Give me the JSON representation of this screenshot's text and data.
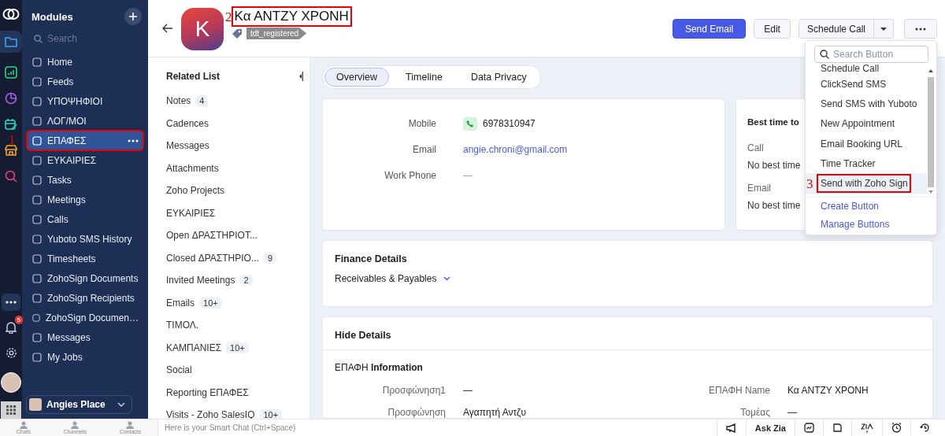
{
  "rail": {
    "notification_count": "5"
  },
  "sidebar": {
    "title": "Modules",
    "search": {
      "placeholder": "Search"
    },
    "items": [
      {
        "label": "Home",
        "selected": false
      },
      {
        "label": "Feeds",
        "selected": false
      },
      {
        "label": "ΥΠΟΨΗΦΙΟΙ",
        "selected": false
      },
      {
        "label": "ΛΟΓ/ΜΟΙ",
        "selected": false
      },
      {
        "label": "ΕΠΑΦΕΣ",
        "selected": true,
        "annotation": "1"
      },
      {
        "label": "ΕΥΚΑΙΡΙΕΣ",
        "selected": false
      },
      {
        "label": "Tasks",
        "selected": false
      },
      {
        "label": "Meetings",
        "selected": false
      },
      {
        "label": "Calls",
        "selected": false
      },
      {
        "label": "Yuboto SMS History",
        "selected": false
      },
      {
        "label": "Timesheets",
        "selected": false
      },
      {
        "label": "ZohoSign Documents",
        "selected": false
      },
      {
        "label": "ZohoSign Recipients",
        "selected": false
      },
      {
        "label": "ZohoSign Documen…",
        "selected": false
      },
      {
        "label": "Messages",
        "selected": false
      },
      {
        "label": "My Jobs",
        "selected": false
      }
    ],
    "org": "Angies Place"
  },
  "header": {
    "avatar_letter": "K",
    "name": "Κα ΑΝΤΖΥ ΧΡΟΝΗ",
    "annotation": "2",
    "tag": "tdt_registered",
    "send_email": "Send Email",
    "edit": "Edit",
    "schedule_call": "Schedule Call"
  },
  "related": {
    "title": "Related List",
    "items": [
      {
        "label": "Notes",
        "count": "4"
      },
      {
        "label": "Cadences"
      },
      {
        "label": "Messages"
      },
      {
        "label": "Attachments"
      },
      {
        "label": "Zoho Projects"
      },
      {
        "label": "ΕΥΚΑΙΡΙΕΣ"
      },
      {
        "label": "Open ΔΡΑΣΤΗΡΙΟΤ..."
      },
      {
        "label": "Closed ΔΡΑΣΤΗΡΙΟ...",
        "count": "9"
      },
      {
        "label": "Invited Meetings",
        "count": "2"
      },
      {
        "label": "Emails",
        "count": "10+"
      },
      {
        "label": "ΤΙΜΟΛ."
      },
      {
        "label": "ΚΑΜΠΑΝΙΕΣ",
        "count": "10+"
      },
      {
        "label": "Social"
      },
      {
        "label": "Reporting ΕΠΑΦΕΣ"
      },
      {
        "label": "Visits - Zoho SalesIQ",
        "count": "10+"
      }
    ]
  },
  "tabs": [
    {
      "label": "Overview",
      "selected": true
    },
    {
      "label": "Timeline",
      "selected": false
    },
    {
      "label": "Data Privacy",
      "selected": false
    }
  ],
  "contact_card": {
    "fields": [
      {
        "label": "Mobile",
        "value": "6978310947",
        "kind": "phone"
      },
      {
        "label": "Email",
        "value": "angie.chroni@gmail.com",
        "kind": "link"
      },
      {
        "label": "Work Phone",
        "value": "—",
        "kind": "empty"
      }
    ]
  },
  "best_time": {
    "title": "Best time to",
    "rows": [
      {
        "label": "Call",
        "value": "No best time"
      },
      {
        "label": "Email",
        "value": "No best time"
      }
    ]
  },
  "finance": {
    "title": "Finance Details",
    "toggle": "Receivables & Payables"
  },
  "details": {
    "title": "Hide Details",
    "section": "ΕΠΑΦΗ **Information**",
    "fields": [
      {
        "label": "Προσφώνηση1",
        "value": "—"
      },
      {
        "label": "ΕΠΑΦΗ Name",
        "value": "Κα ΑΝΤΖΥ ΧΡΟΝΗ"
      },
      {
        "label": "Προσφώνηση",
        "value": "Αγαπητή Αντζυ"
      },
      {
        "label": "Τομέας",
        "value": "—"
      }
    ]
  },
  "dropdown": {
    "search": {
      "placeholder": "Search Button"
    },
    "items": [
      {
        "label": "Schedule Call",
        "selected": false
      },
      {
        "label": "ClickSend SMS",
        "selected": false
      },
      {
        "label": "Send SMS with Yuboto",
        "selected": false
      },
      {
        "label": "New Appointment",
        "selected": false
      },
      {
        "label": "Email Booking URL",
        "selected": false
      },
      {
        "label": "Time Tracker",
        "selected": false
      },
      {
        "label": "Send with Zoho Sign",
        "selected": true,
        "annotation": "3"
      }
    ],
    "links": [
      "Create Button",
      "Manage Buttons"
    ]
  },
  "dock": [
    "Chats",
    "Channels",
    "Contacts"
  ],
  "smart_chat": {
    "placeholder": "Here is your Smart Chat (Ctrl+Space)"
  },
  "footer": {
    "ask_zia": "Ask Zia"
  }
}
